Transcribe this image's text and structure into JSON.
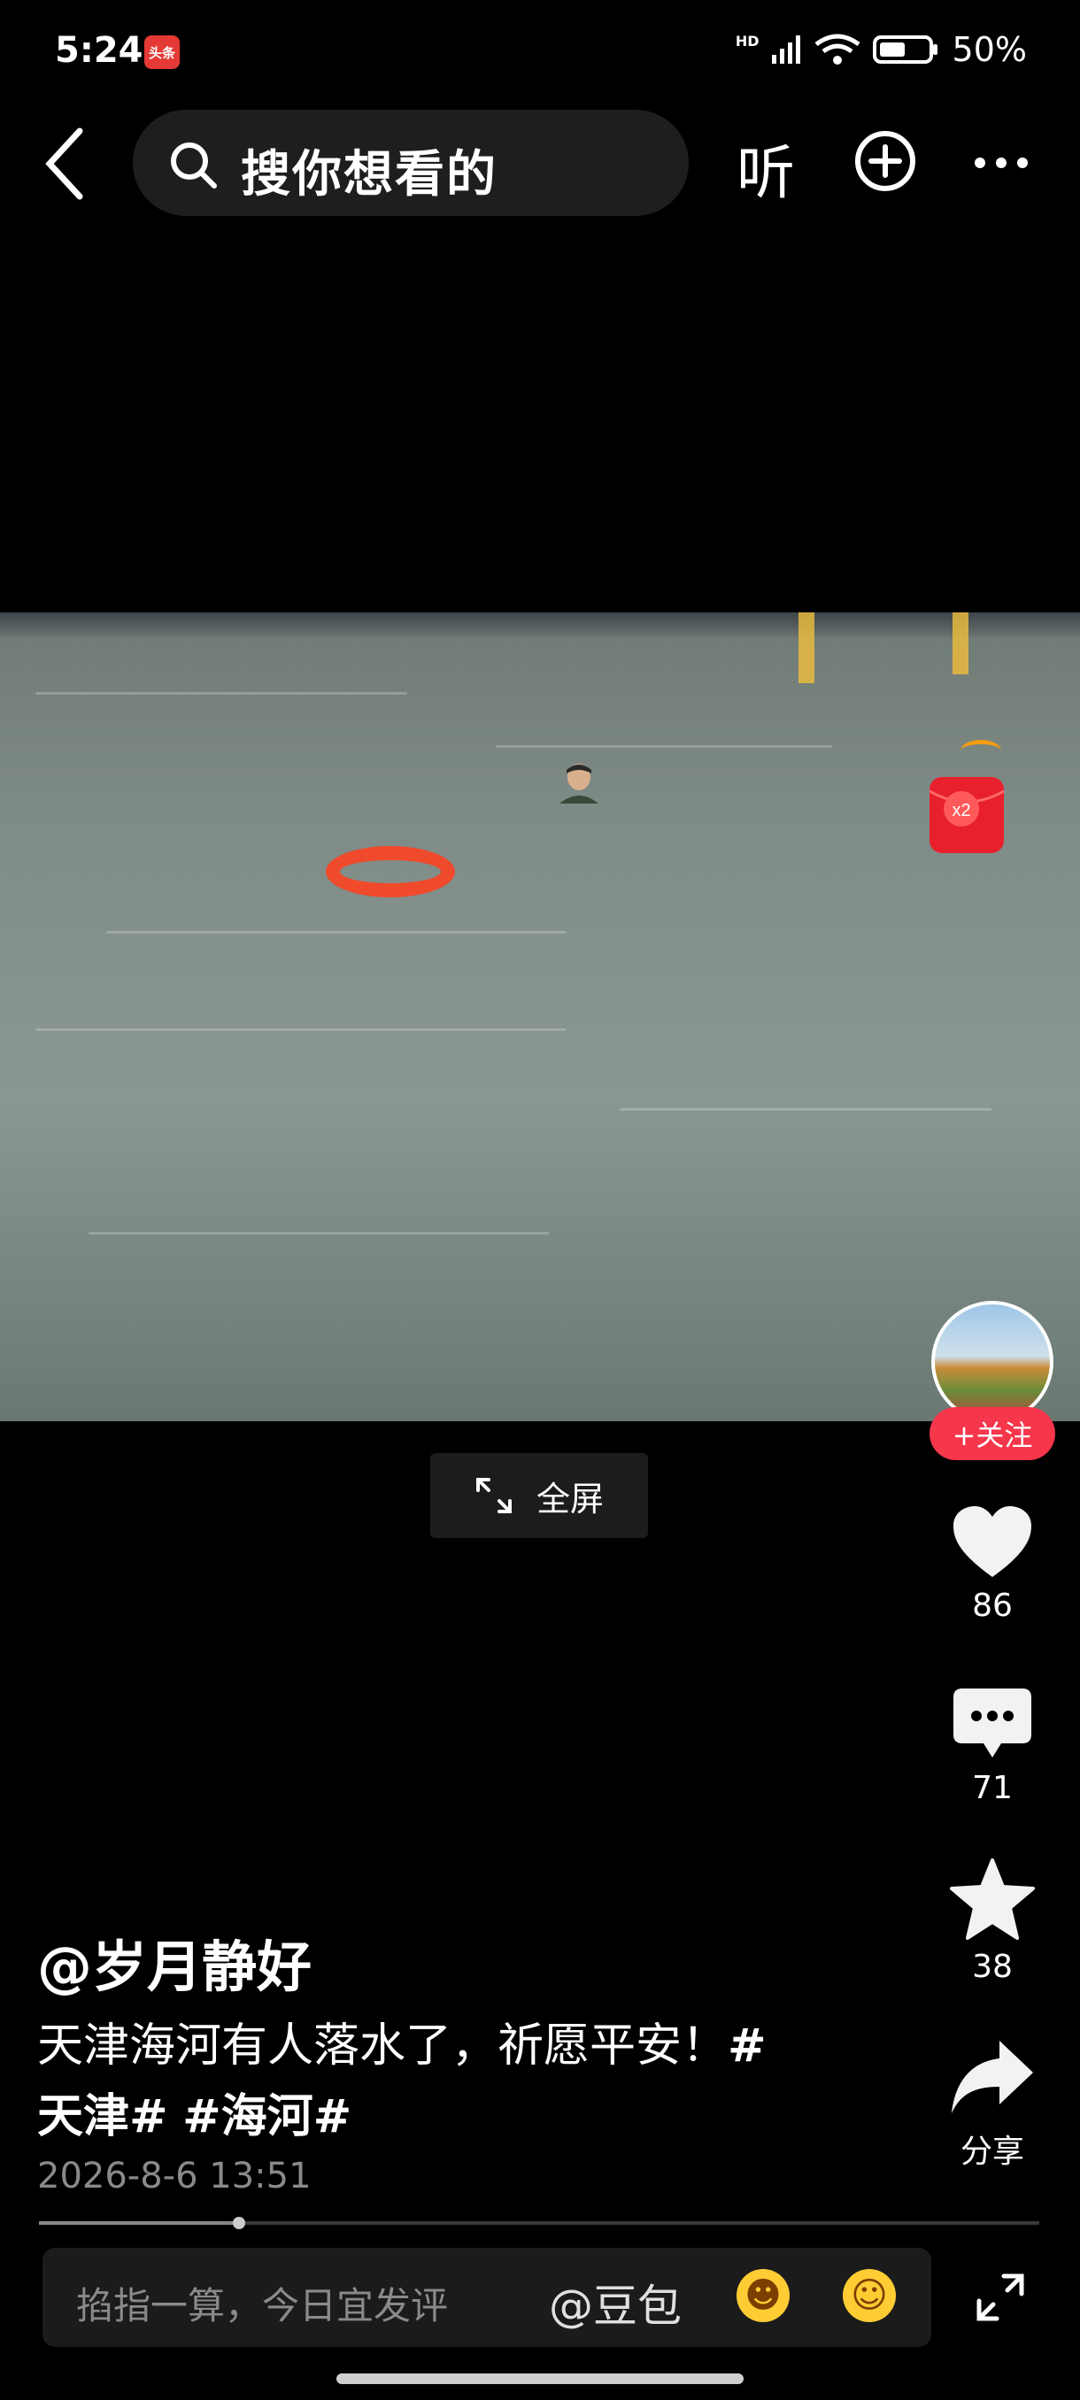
{
  "status_bar": {
    "time": "5:24",
    "app_badge": "头条",
    "network": "HD",
    "wifi_label": "6",
    "battery": "50%"
  },
  "top_nav": {
    "search_placeholder": "搜你想看的",
    "listen_label": "听"
  },
  "video": {
    "fullscreen_label": "全屏",
    "redpack_label": "x2"
  },
  "right_rail": {
    "follow_label": "+关注",
    "like_count": "86",
    "comment_count": "71",
    "favorite_count": "38",
    "share_label": "分享"
  },
  "post": {
    "author": "@岁月静好",
    "text": "天津海河有人落水了，祈愿平安！",
    "tag1_start": "#",
    "tag1_end": "天津#",
    "tag2": "#海河#",
    "date": "2026-8-6 13:51",
    "progress": 0.2
  },
  "comment_bar": {
    "placeholder": "掐指一算，今日宜发评",
    "mention": "@豆包"
  },
  "colors": {
    "accent_red": "#f5364b",
    "background": "#000000"
  }
}
